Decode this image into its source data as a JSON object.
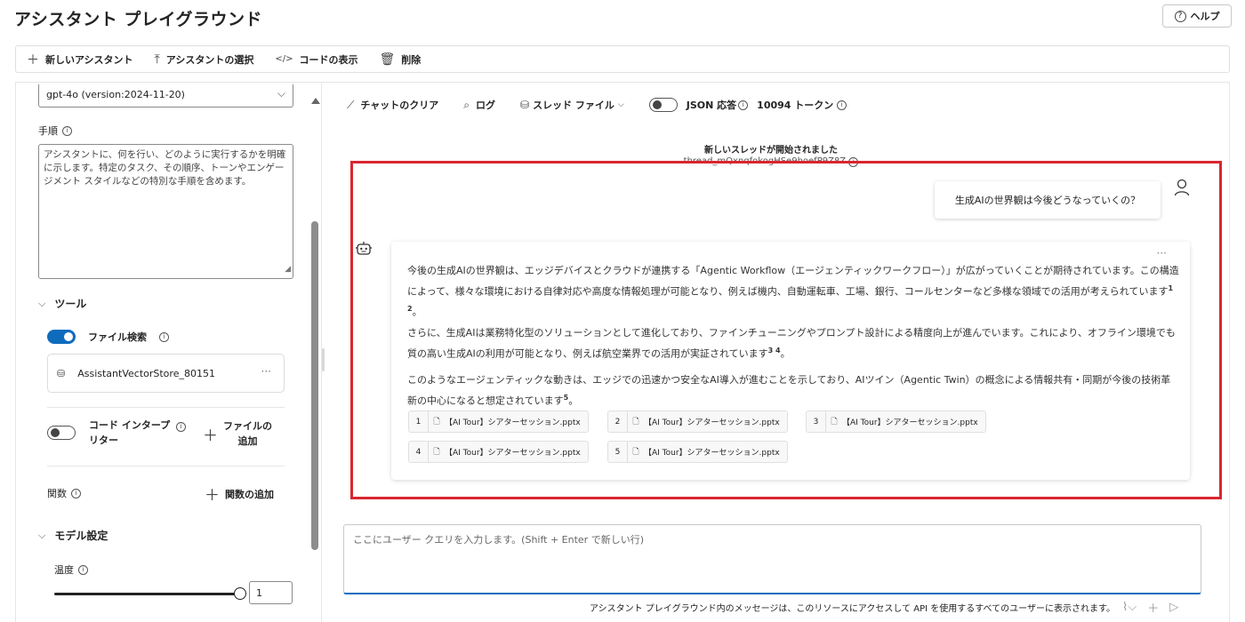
{
  "page": {
    "title": "アシスタント プレイグラウンド",
    "help_label": "ヘルプ"
  },
  "toolbar": {
    "new_assistant": "新しいアシスタント",
    "select_assistant": "アシスタントの選択",
    "view_code": "コードの表示",
    "delete": "削除"
  },
  "left": {
    "model": "gpt-4o (version:2024-11-20)",
    "instructions_label": "手順",
    "instructions_text": "アシスタントに、何を行い、どのように実行するかを明確に示します。特定のタスク、その順序、トーンやエンゲージメント スタイルなどの特別な手順を含めます。",
    "tools_header": "ツール",
    "file_search_label": "ファイル検索",
    "file_search_enabled": true,
    "vector_store": "AssistantVectorStore_80151",
    "code_interpreter_label_1": "コード インタープ",
    "code_interpreter_label_2": "リター",
    "code_interpreter_enabled": false,
    "add_file_1": "ファイルの",
    "add_file_2": "追加",
    "functions_label": "関数",
    "add_function": "関数の追加",
    "model_settings_header": "モデル設定",
    "temperature_label": "温度",
    "temperature_value": "1"
  },
  "chat": {
    "clear_chat": "チャットのクリア",
    "logs": "ログ",
    "thread_files": "スレッド ファイル",
    "json_response": "JSON 応答",
    "json_enabled": false,
    "tokens": "10094 トークン",
    "thread_started": "新しいスレッドが開始されました",
    "thread_id": "thread_mQxnqfokogHSe9hoefP9Z8Z",
    "user_message": "生成AIの世界観は今後どうなっていくの？",
    "assistant": {
      "p1": "今後の生成AIの世界観は、エッジデバイスとクラウドが連携する「Agentic Workflow（エージェンティックワークフロー）」が広がっていくことが期待されています。この構造によって、様々な環境における自律対応や高度な情報処理が可能となり、例えば機内、自動運転車、工場、銀行、コールセンターなど多様な領域での活用が考えられています",
      "p1_refs": "1 2",
      "p2": "さらに、生成AIは業務特化型のソリューションとして進化しており、ファインチューニングやプロンプト設計による精度向上が進んでいます。これにより、オフライン環境でも質の高い生成AIの利用が可能となり、例えば航空業界での活用が実証されています",
      "p2_refs": "3 4",
      "p3": "このようなエージェンティックな動きは、エッジでの迅速かつ安全なAI導入が進むことを示しており、AIツイン（Agentic Twin）の概念による情報共有・同期が今後の技術革新の中心になると想定されています",
      "p3_refs": "5",
      "end_mark": "。",
      "citations": [
        {
          "num": "1",
          "file": "【AI Tour】シアターセッション.pptx"
        },
        {
          "num": "2",
          "file": "【AI Tour】シアターセッション.pptx"
        },
        {
          "num": "3",
          "file": "【AI Tour】シアターセッション.pptx"
        },
        {
          "num": "4",
          "file": "【AI Tour】シアターセッション.pptx"
        },
        {
          "num": "5",
          "file": "【AI Tour】シアターセッション.pptx"
        }
      ]
    },
    "query_placeholder": "ここにユーザー クエリを入力します。(Shift + Enter で新しい行)",
    "footer_note": "アシスタント プレイグラウンド内のメッセージは、このリソースにアクセスして API を使用するすべてのユーザーに表示されます。"
  },
  "colors": {
    "accent": "#0f6cbd",
    "highlight": "#d9262f"
  },
  "icons": [
    "plus-icon",
    "upload-icon",
    "code-icon",
    "trash-icon",
    "help-icon",
    "broom-icon",
    "search-icon",
    "database-icon",
    "info-icon",
    "person-icon",
    "bot-icon",
    "file-icon",
    "attach-icon",
    "send-icon"
  ]
}
